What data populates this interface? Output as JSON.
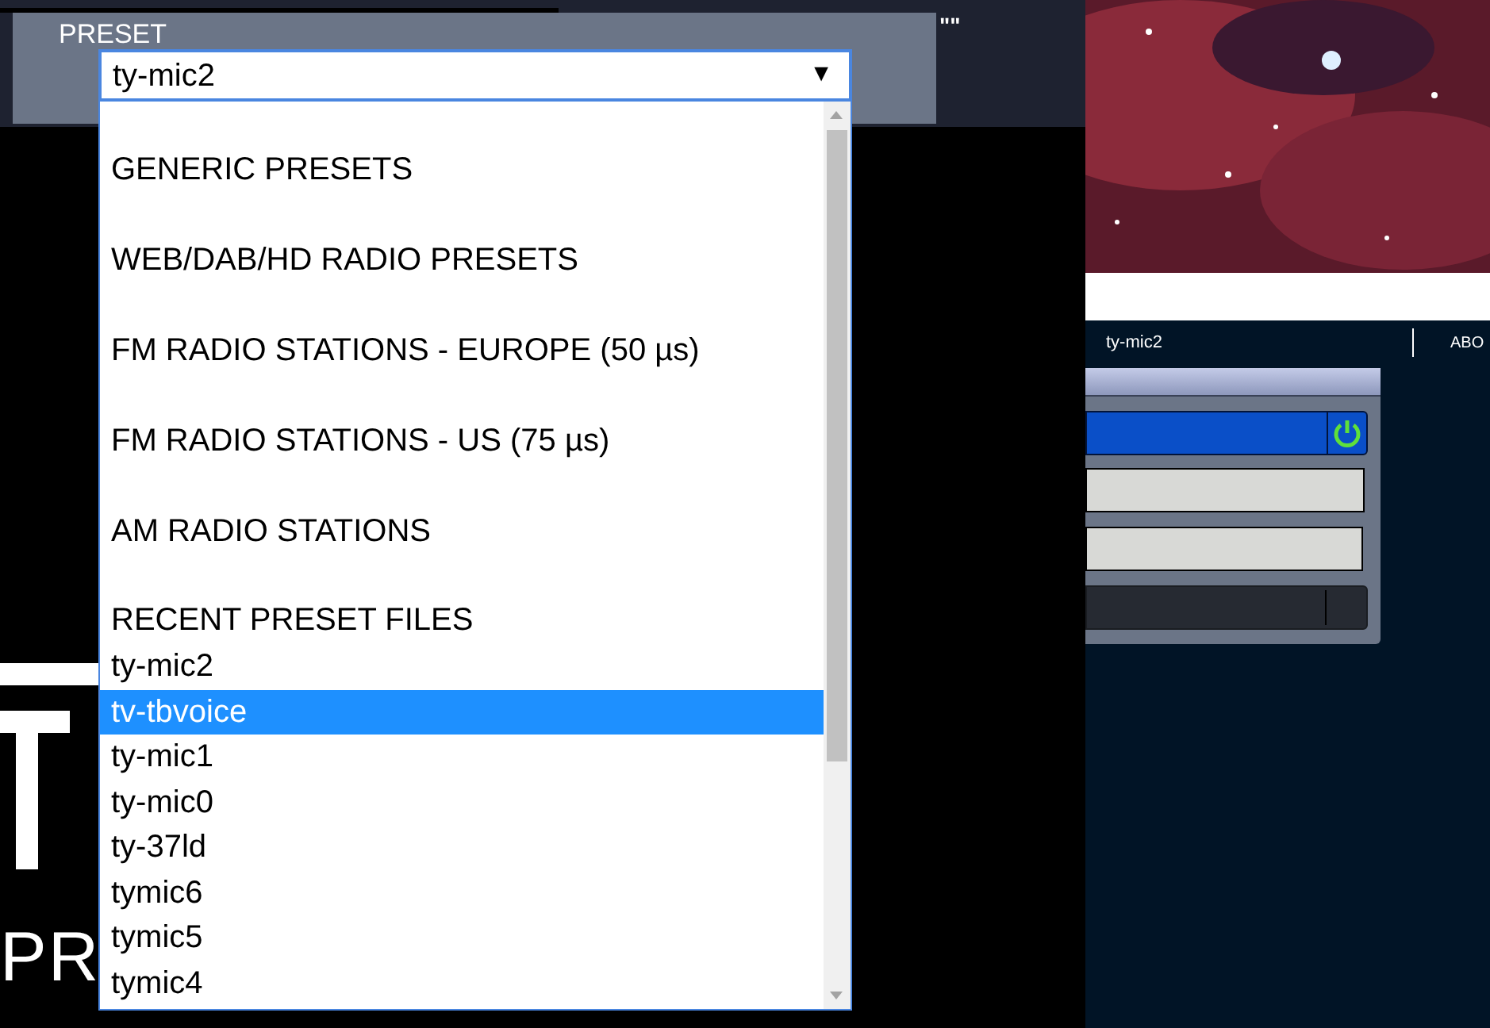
{
  "preset": {
    "label": "PRESET",
    "value": "ty-mic2",
    "arrow": "▼"
  },
  "stray_text": "\"\"",
  "dropdown": {
    "items": [
      {
        "kind": "group",
        "label": "GENERIC PRESETS"
      },
      {
        "kind": "group",
        "label": "WEB/DAB/HD RADIO PRESETS"
      },
      {
        "kind": "group",
        "label": "FM RADIO STATIONS - EUROPE (50 µs)"
      },
      {
        "kind": "group",
        "label": "FM RADIO STATIONS - US (75 µs)"
      },
      {
        "kind": "group",
        "label": "AM RADIO STATIONS"
      },
      {
        "kind": "heading",
        "label": "RECENT PRESET FILES"
      },
      {
        "kind": "option",
        "label": "ty-mic2",
        "selected": false
      },
      {
        "kind": "option",
        "label": "tv-tbvoice",
        "selected": true
      },
      {
        "kind": "option",
        "label": "ty-mic1",
        "selected": false
      },
      {
        "kind": "option",
        "label": "ty-mic0",
        "selected": false
      },
      {
        "kind": "option",
        "label": "ty-37ld",
        "selected": false
      },
      {
        "kind": "option",
        "label": "tymic6",
        "selected": false
      },
      {
        "kind": "option",
        "label": "tymic5",
        "selected": false
      },
      {
        "kind": "option",
        "label": "tymic4",
        "selected": false
      }
    ]
  },
  "logo": {
    "text": "PR"
  },
  "nav": {
    "items": [
      "ty-mic2",
      "ABO"
    ]
  }
}
